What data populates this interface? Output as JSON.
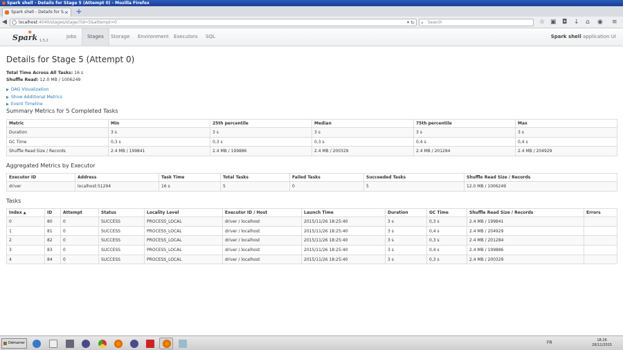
{
  "window": {
    "title": "Spark shell - Details for Stage 5 (Attempt 0) - Mozilla Firefox"
  },
  "browser": {
    "tab_title": "Spark shell - Details for S...",
    "url_host": "localhost",
    "url_path": ":4040/stages/stage/?id=5&attempt=0",
    "search_placeholder": "Search"
  },
  "sparknav": {
    "version": "1.5.2",
    "tabs": [
      "Jobs",
      "Stages",
      "Storage",
      "Environment",
      "Executors",
      "SQL"
    ],
    "active_tab": "Stages",
    "app_name": "Spark shell",
    "app_suffix": " application UI"
  },
  "page": {
    "title": "Details for Stage 5 (Attempt 0)",
    "total_time_label": "Total Time Across All Tasks:",
    "total_time_value": " 16 s",
    "shuffle_read_label": "Shuffle Read:",
    "shuffle_read_value": " 12.0 MB / 1006249",
    "links": [
      "DAG Visualization",
      "Show Additional Metrics",
      "Event Timeline"
    ]
  },
  "summary_metrics": {
    "title": "Summary Metrics for 5 Completed Tasks",
    "headers": [
      "Metric",
      "Min",
      "25th percentile",
      "Median",
      "75th percentile",
      "Max"
    ],
    "rows": [
      [
        "Duration",
        "3 s",
        "3 s",
        "3 s",
        "3 s",
        "3 s"
      ],
      [
        "GC Time",
        "0,3 s",
        "0,3 s",
        "0,3 s",
        "0,4 s",
        "0,4 s"
      ],
      [
        "Shuffle Read Size / Records",
        "2.4 MB / 199841",
        "2.4 MB / 199886",
        "2.4 MB / 200329",
        "2.4 MB / 201284",
        "2.4 MB / 204929"
      ]
    ]
  },
  "executor_metrics": {
    "title": "Aggregated Metrics by Executor",
    "headers": [
      "Executor ID",
      "Address",
      "Task Time",
      "Total Tasks",
      "Failed Tasks",
      "Succeeded Tasks",
      "Shuffle Read Size / Records"
    ],
    "rows": [
      [
        "driver",
        "localhost:51294",
        "16 s",
        "5",
        "0",
        "5",
        "12.0 MB / 1006249"
      ]
    ]
  },
  "tasks": {
    "title": "Tasks",
    "sort_indicator": "▲",
    "headers": [
      "Index",
      "ID",
      "Attempt",
      "Status",
      "Locality Level",
      "Executor ID / Host",
      "Launch Time",
      "Duration",
      "GC Time",
      "Shuffle Read Size / Records",
      "Errors"
    ],
    "rows": [
      [
        "0",
        "80",
        "0",
        "SUCCESS",
        "PROCESS_LOCAL",
        "driver / localhost",
        "2015/11/26 18:25:40",
        "3 s",
        "0,3 s",
        "2.4 MB / 199841",
        ""
      ],
      [
        "1",
        "81",
        "0",
        "SUCCESS",
        "PROCESS_LOCAL",
        "driver / localhost",
        "2015/11/26 18:25:40",
        "3 s",
        "0,4 s",
        "2.4 MB / 204929",
        ""
      ],
      [
        "2",
        "82",
        "0",
        "SUCCESS",
        "PROCESS_LOCAL",
        "driver / localhost",
        "2015/11/26 18:25:40",
        "3 s",
        "0,3 s",
        "2.4 MB / 201284",
        ""
      ],
      [
        "3",
        "83",
        "0",
        "SUCCESS",
        "PROCESS_LOCAL",
        "driver / localhost",
        "2015/11/26 18:25:40",
        "3 s",
        "0,4 s",
        "2.4 MB / 199886",
        ""
      ],
      [
        "4",
        "84",
        "0",
        "SUCCESS",
        "PROCESS_LOCAL",
        "driver / localhost",
        "2015/11/26 18:25:40",
        "3 s",
        "0,3 s",
        "2.4 MB / 200329",
        ""
      ]
    ]
  },
  "taskbar": {
    "start_label": "Démarrer",
    "lang": "FR",
    "time": "18:26",
    "date": "26/11/2015",
    "app_icons": [
      "explorer-icon",
      "app-icon",
      "network-icon",
      "eclipse-icon",
      "chrome-icon",
      "firefox-icon",
      "eclipse-icon",
      "pdf-icon",
      "firefox-icon",
      "recycle-icon"
    ]
  },
  "colors": {
    "link": "#2a7ab8",
    "spark_orange": "#e25a1c",
    "title_bar": "#2a5bbf"
  }
}
